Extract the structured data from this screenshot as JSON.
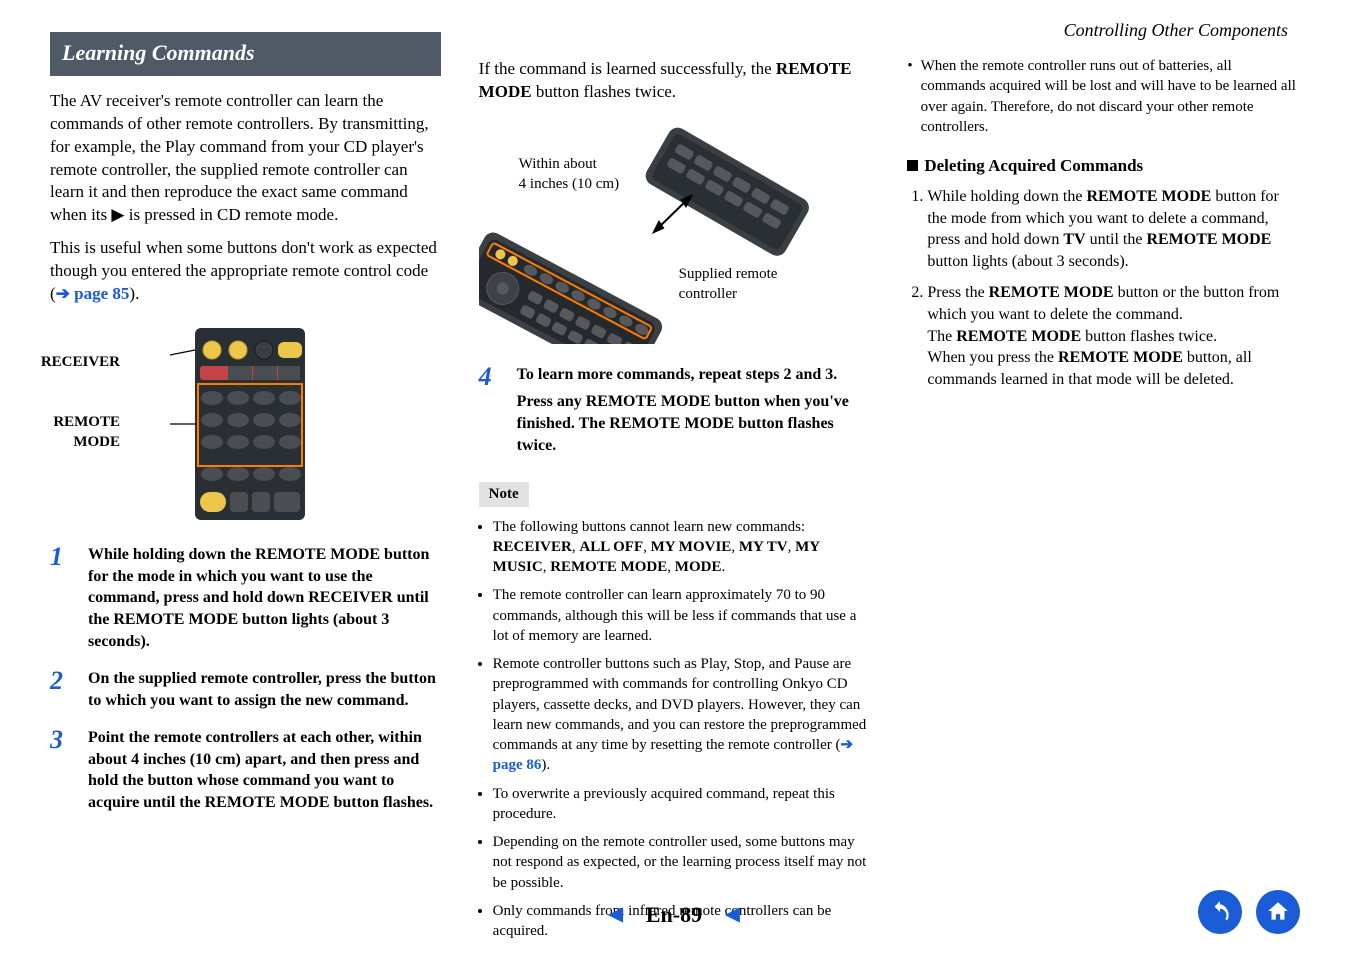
{
  "header": {
    "breadcrumb": "Controlling Other Components"
  },
  "col1": {
    "title": "Learning Commands",
    "intro1": "The AV receiver's remote controller can learn the commands of other remote controllers. By transmitting, for example, the Play command from your CD player's remote controller, the supplied remote controller can learn it and then reproduce the exact same command when its ",
    "intro1_end": " is pressed in CD remote mode.",
    "intro2_a": "This is useful when some buttons don't work as expected though you entered the appropriate remote control code (",
    "link1_arrow": "➔ ",
    "link1_text": "page 85",
    "intro2_b": ").",
    "fig": {
      "receiverLabel": "RECEIVER",
      "remoteModeLabel": "REMOTE MODE"
    },
    "steps": {
      "s1": {
        "num": "1",
        "a": "While holding down the ",
        "b": "REMOTE MODE",
        "c": " button for the mode in which you want to use the command, press and hold down ",
        "d": "RECEIVER",
        "e": " until the ",
        "f": "REMOTE MODE",
        "g": " button lights (about 3 seconds)."
      },
      "s2": {
        "num": "2",
        "text": "On the supplied remote controller, press the button to which you want to assign the new command."
      },
      "s3": {
        "num": "3",
        "a": "Point the remote controllers at each other, within about 4 inches (10 cm) apart, and then press and hold the button whose command you want to acquire until the ",
        "b": "REMOTE MODE",
        "c": " button flashes."
      }
    }
  },
  "col2": {
    "top_a": "If the command is learned successfully, the ",
    "top_b": "REMOTE MODE",
    "top_c": " button flashes twice.",
    "diagram": {
      "distance1": "Within about",
      "distance2": "4 inches (10 cm)",
      "supplied1": "Supplied remote",
      "supplied2": "controller"
    },
    "step4": {
      "num": "4",
      "line1": "To learn more commands, repeat steps 2 and 3.",
      "line2_a": "Press any ",
      "line2_b": "REMOTE MODE",
      "line2_c": " button when you've finished. The ",
      "line2_d": "REMOTE MODE",
      "line2_e": " button flashes twice."
    },
    "note_hdr": "Note",
    "notes": {
      "n1_a": "The following buttons cannot learn new commands:",
      "n1_b": "RECEIVER",
      "n1_c": "ALL OFF",
      "n1_d": "MY MOVIE",
      "n1_e": "MY TV",
      "n1_f": "MY MUSIC",
      "n1_g": "REMOTE MODE",
      "n1_h": "MODE",
      "n2": "The remote controller can learn approximately 70 to 90 commands, although this will be less if commands that use a lot of memory are learned.",
      "n3_a": "Remote controller buttons such as Play, Stop, and Pause are preprogrammed with commands for controlling Onkyo CD players, cassette decks, and DVD players. However, they can learn new commands, and you can restore the preprogrammed commands at any time by resetting the remote controller (",
      "n3_link_arrow": "➔ ",
      "n3_link_text": "page 86",
      "n3_b": ").",
      "n4": "To overwrite a previously acquired command, repeat this procedure.",
      "n5": "Depending on the remote controller used, some buttons may not respond as expected, or the learning process itself may not be possible.",
      "n6": "Only commands from infrared remote controllers can be acquired."
    }
  },
  "col3": {
    "top_bullet": "When the remote controller runs out of batteries, all commands acquired will be lost and will have to be learned all over again. Therefore, do not discard your other remote controllers.",
    "subhead": "Deleting Acquired Commands",
    "d1_a": "While holding down the ",
    "d1_b": "REMOTE MODE",
    "d1_c": " button for the mode from which you want to delete a command, press and hold down ",
    "d1_d": "TV",
    "d1_e": " until the ",
    "d1_f": "REMOTE MODE",
    "d1_g": " button lights (about 3 seconds).",
    "d2_a": "Press the ",
    "d2_b": "REMOTE MODE",
    "d2_c": " button or the button from which you want to delete the command.",
    "d2_d": "The ",
    "d2_e": "REMOTE MODE",
    "d2_f": " button flashes twice.",
    "d2_g": "When you press the ",
    "d2_h": "REMOTE MODE",
    "d2_i": " button, all commands learned in that mode will be deleted."
  },
  "footer": {
    "prev_glyph": "▲",
    "page_label": "En-89",
    "next_glyph": "▼"
  }
}
